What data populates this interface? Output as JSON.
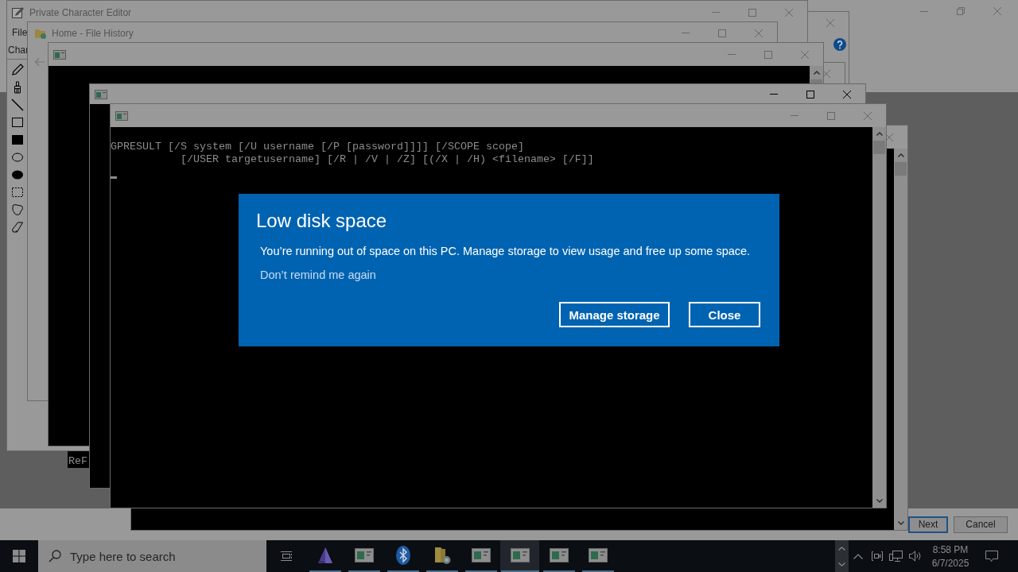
{
  "windows": [
    {
      "kind": "wizard",
      "active": false,
      "maximized": true,
      "buttons": [
        {
          "label": "Next",
          "default": true
        },
        {
          "label": "Cancel",
          "default": false
        }
      ]
    },
    {
      "kind": "help_dialog",
      "active": false
    },
    {
      "kind": "dialog",
      "active": false
    },
    {
      "kind": "character_editor",
      "active": false,
      "title": "Private Character Editor",
      "menu": [
        "File"
      ],
      "toolbar_label": "Char"
    },
    {
      "kind": "file_history",
      "active": false,
      "title": "Home - File History"
    },
    {
      "kind": "console",
      "active": false
    },
    {
      "kind": "console",
      "active": false
    },
    {
      "kind": "console",
      "active": true
    },
    {
      "kind": "console",
      "active": false,
      "lines": [
        "GPRESULT [/S system [/U username [/P [password]]]] [/SCOPE scope]",
        "           [/USER targetusername] [/R | /V | /Z] [(/X | /H) <filename> [/F]]"
      ],
      "cursor": true
    },
    {
      "kind": "console",
      "lines": [
        "ReF"
      ]
    }
  ],
  "notification": {
    "title": "Low disk space",
    "message": "You’re running out of space on this PC. Manage storage to view usage and free up some space.",
    "link": "Don’t remind me again",
    "buttons": [
      {
        "label": "Manage storage"
      },
      {
        "label": "Close"
      }
    ]
  },
  "taskbar": {
    "search": {
      "placeholder": "Type here to search"
    },
    "apps": [
      {
        "kind": "editor",
        "running": true,
        "selected": false
      },
      {
        "kind": "console",
        "running": true,
        "selected": false
      },
      {
        "kind": "bluetooth",
        "running": true,
        "selected": false
      },
      {
        "kind": "folder",
        "running": true,
        "selected": false
      },
      {
        "kind": "console",
        "running": true,
        "selected": false
      },
      {
        "kind": "console",
        "running": true,
        "selected": true
      },
      {
        "kind": "console",
        "running": true,
        "selected": false
      },
      {
        "kind": "console",
        "running": true,
        "selected": false
      }
    ],
    "clock": {
      "time": "8:58 PM",
      "date": "6/7/2025"
    }
  }
}
